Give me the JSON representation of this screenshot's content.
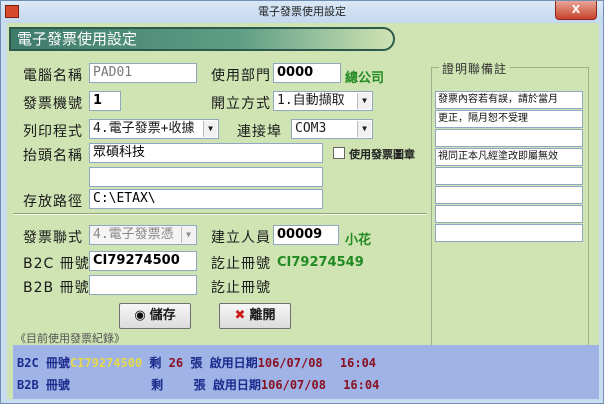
{
  "window": {
    "title": "電子發票使用設定",
    "close_label": "X"
  },
  "banner": "電子發票使用設定",
  "form": {
    "computer_name_label": "電腦名稱",
    "computer_name": "PAD01",
    "department_label": "使用部門",
    "department_code": "0000",
    "department_name": "總公司",
    "machine_no_label": "發票機號",
    "machine_no": "1",
    "open_mode_label": "開立方式",
    "open_mode": "1.自動擷取",
    "print_program_label": "列印程式",
    "print_program": "4.電子發票+收據",
    "port_label": "連接埠",
    "port": "COM3",
    "header_label": "抬頭名稱",
    "header_value": "眾碩科技",
    "header_value2": "",
    "use_seal_label": "使用發票圖章",
    "save_path_label": "存放路徑",
    "save_path": "C:\\ETAX\\",
    "invoice_type_label": "發票聯式",
    "invoice_type": "4.電子發票憑",
    "creator_label": "建立人員",
    "creator_code": "00009",
    "creator_name": "小花",
    "b2c_label": "B2C 冊號",
    "b2c_no": "CI79274500",
    "end_label": "訖止冊號",
    "b2c_end": "CI79274549",
    "b2b_label": "B2B 冊號",
    "b2b_no": "",
    "b2b_end_label": "訖止冊號"
  },
  "notes": {
    "legend": "證明聯備註",
    "lines": [
      "發票內容若有誤，請於當月",
      "更正，隔月恕不受理",
      "",
      "視同正本凡經塗改即屬無效",
      "",
      "",
      "",
      ""
    ]
  },
  "buttons": {
    "save": "儲存",
    "leave": "離開"
  },
  "records": {
    "legend": "《目前使用發票紀錄》",
    "rows": [
      {
        "type": "B2C",
        "book_label": "冊號",
        "book_no": "CI79274500",
        "remain_label": "剩",
        "remain": "26",
        "unit": "張",
        "start_label": "啟用日期",
        "date": "106/07/08",
        "time": "16:04"
      },
      {
        "type": "B2B",
        "book_label": "冊號",
        "book_no": "",
        "remain_label": "剩",
        "remain": "",
        "unit": "張",
        "start_label": "啟用日期",
        "date": "106/07/08",
        "time": "16:04"
      }
    ]
  }
}
